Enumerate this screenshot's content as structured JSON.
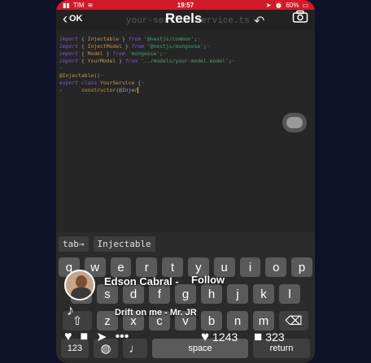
{
  "status_bar": {
    "carrier": "TIM",
    "time": "19:57",
    "battery": "60%"
  },
  "app_bar": {
    "back_label": "OK",
    "filename": "your-service.service.ts",
    "overlay_title": "Reels"
  },
  "editor": {
    "lines": [
      {
        "parts": [
          [
            "kw",
            "import "
          ],
          [
            "br",
            "{ "
          ],
          [
            "id",
            "Injectable"
          ],
          [
            "br",
            " } "
          ],
          [
            "kw",
            "from "
          ],
          [
            "str",
            "'@nestjs/common'"
          ],
          [
            "br",
            ";"
          ],
          [
            "dot",
            "¬"
          ]
        ]
      },
      {
        "parts": [
          [
            "kw",
            "import "
          ],
          [
            "br",
            "{ "
          ],
          [
            "id",
            "InjectModel"
          ],
          [
            "br",
            " } "
          ],
          [
            "kw",
            "from "
          ],
          [
            "str",
            "'@nestjs/mongoose'"
          ],
          [
            "br",
            ";"
          ],
          [
            "dot",
            "¬"
          ]
        ]
      },
      {
        "parts": [
          [
            "kw",
            "import "
          ],
          [
            "br",
            "{ "
          ],
          [
            "id",
            "Model"
          ],
          [
            "br",
            " } "
          ],
          [
            "kw",
            "from "
          ],
          [
            "str",
            "'mongoose'"
          ],
          [
            "br",
            ";"
          ],
          [
            "dot",
            "¬"
          ]
        ]
      },
      {
        "parts": [
          [
            "kw",
            "import "
          ],
          [
            "br",
            "{ "
          ],
          [
            "id",
            "YourModel"
          ],
          [
            "br",
            " } "
          ],
          [
            "kw",
            "from "
          ],
          [
            "str",
            "'../models/your-model.model'"
          ],
          [
            "br",
            ";"
          ],
          [
            "dot",
            "¬"
          ]
        ]
      },
      {
        "parts": [
          [
            "dot",
            "¬"
          ]
        ]
      },
      {
        "parts": [
          [
            "cls",
            "@Injectable"
          ],
          [
            "br",
            "()"
          ],
          [
            "dot",
            "¬"
          ]
        ]
      },
      {
        "parts": [
          [
            "kw",
            "export "
          ],
          [
            "kw",
            "class "
          ],
          [
            "cls",
            "YourService "
          ],
          [
            "br",
            "{"
          ],
          [
            "dot",
            "¬"
          ]
        ]
      },
      {
        "parts": [
          [
            "dot",
            "▸      "
          ],
          [
            "cls",
            "constructor"
          ],
          [
            "br",
            "(@Injer"
          ]
        ]
      }
    ]
  },
  "keyboard": {
    "suggestions": [
      "tab→",
      "Injectable"
    ],
    "row1": [
      "q",
      "w",
      "e",
      "r",
      "t",
      "y",
      "u",
      "i",
      "o",
      "p"
    ],
    "row2": [
      "a",
      "s",
      "d",
      "f",
      "g",
      "h",
      "j",
      "k",
      "l"
    ],
    "row3": [
      "z",
      "x",
      "c",
      "v",
      "b",
      "n",
      "m"
    ],
    "bottom": {
      "numbers": "123",
      "space": "space",
      "return": "return"
    }
  },
  "reel": {
    "username": "Edson Cabral -",
    "follow": "Follow",
    "song": "Drift on me - Mr. JR",
    "likes": "1243",
    "comments": "323"
  },
  "icons": {
    "back": "chevron-left-icon",
    "undo": "undo-icon",
    "camera": "camera-icon",
    "music": "music-note-icon",
    "heart": "heart-icon",
    "comment": "comment-icon",
    "share": "share-icon",
    "more": "more-icon",
    "shift": "shift-icon",
    "backspace": "backspace-icon",
    "globe": "globe-icon",
    "mic": "mic-icon"
  },
  "colors": {
    "status_bar": "#d11a2a",
    "keyword": "#7d5ad8",
    "string": "#4fa070",
    "identifier": "#c79a48"
  }
}
